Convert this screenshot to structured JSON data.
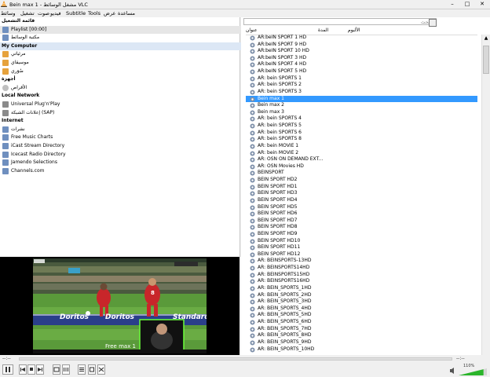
{
  "window": {
    "title": "Bein max 1 - مشغل الوسائط VLC",
    "controls": [
      "–",
      "□",
      "✕"
    ]
  },
  "menu": [
    "وسائط",
    "تشغيل",
    "صوت",
    "فيديو",
    "Subtitle",
    "Tools",
    "عرض",
    "مساعدة"
  ],
  "sidebar": {
    "sections": [
      {
        "header": "قائمة التشغيل",
        "items": [
          {
            "label": "Playlist [00:00]",
            "icon": "playlist-icon",
            "selected": true
          },
          {
            "label": "مكتبة الوسائط",
            "icon": "library-icon"
          }
        ]
      },
      {
        "header": "My Computer",
        "highlight": true,
        "items": [
          {
            "label": "مرئياتي",
            "icon": "video-folder-icon"
          },
          {
            "label": "موسيقاي",
            "icon": "music-folder-icon"
          },
          {
            "label": "صُوَري",
            "icon": "pictures-folder-icon"
          }
        ]
      },
      {
        "header": "أجهزة",
        "items": [
          {
            "label": "الأقراص",
            "icon": "disc-icon"
          }
        ]
      },
      {
        "header": "Local Network",
        "items": [
          {
            "label": "Universal Plug'n'Play",
            "icon": "network-icon"
          },
          {
            "label": "إعلانات الشبكة (SAP)",
            "icon": "network-icon"
          }
        ]
      },
      {
        "header": "Internet",
        "items": [
          {
            "label": "نشرات",
            "icon": "podcast-icon"
          },
          {
            "label": "Free Music Charts",
            "icon": "music-charts-icon"
          },
          {
            "label": "iCast Stream Directory",
            "icon": "icast-icon"
          },
          {
            "label": "Icecast Radio Directory",
            "icon": "icecast-icon"
          },
          {
            "label": "Jamendo Selections",
            "icon": "jamendo-icon"
          },
          {
            "label": "Channels.com",
            "icon": "channels-icon"
          }
        ]
      }
    ]
  },
  "video": {
    "overlay_text": "Free max 1",
    "ad_text": "Doritos",
    "ad_text_2": "Standard",
    "player_number": "8"
  },
  "playlist": {
    "search_placeholder": "البحث",
    "columns": {
      "title": "عنوان",
      "duration": "المدة",
      "album": "الألبوم"
    },
    "items": [
      "AR:beIN SPORT 1 HD",
      "AR:beIN SPORT 9 HD",
      "AR:beIN SPORT 10 HD",
      "AR:beIN SPORT 3 HD",
      "AR:beIN SPORT 4 HD",
      "AR:beIN SPORT 5 HD",
      "AR:  bein SPORTS 1",
      "AR: bein SPORTS 2",
      "AR: bein SPORTS 3",
      "Bein max 1",
      "Bein max 2",
      "Bein max 3",
      "AR: bein SPORTS 4",
      "AR: bein SPORTS 5",
      "AR: bein SPORTS 6",
      "AR: bein SPORTS 8",
      "AR: bein MOVIE 1",
      "AR: bein MOVIE 2",
      "AR:  OSN ON DEMAND EXT...",
      "AR:  OSN Movies HD",
      "BEINSPORT",
      "BEIN SPORT HD2",
      "BEIN SPORT HD1",
      "BEIN SPORT HD3",
      "BEIN SPORT HD4",
      "BEIN SPORT HD5",
      "BEIN SPORT HD6",
      "BEIN SPORT HD7",
      "BEIN SPORT HD8",
      "BEIN SPORT HD9",
      "BEIN SPORT HD10",
      "BEIN SPORT HD11",
      "BEIN SPORT HD12",
      "AR: BEINSPORTS-13HD",
      "AR: BEINSPORTS14HD",
      "AR: BEINSPORTS15HD",
      "AR: BEINSPORTS16HD",
      "AR: BEIN_SPORTS_1HD",
      "AR: BEIN_SPORTS_2HD",
      "AR: BEIN_SPORTS_3HD",
      "AR: BEIN_SPORTS_4HD",
      "AR: BEIN_SPORTS_5HD",
      "AR: BEIN_SPORTS_6HD",
      "AR: BEIN_SPORTS_7HD",
      "AR: BEIN_SPORTS_8HD",
      "AR: BEIN_SPORTS_9HD",
      "AR: BEIN_SPORTS_10HD"
    ],
    "selected_index": 9
  },
  "seek": {
    "elapsed": "--:--",
    "remaining": "--:--",
    "position": 0
  },
  "volume": {
    "label": "110%",
    "level": 1.1
  },
  "colors": {
    "selection": "#3399ff",
    "volume": "#2bb52b",
    "section_highlight": "#dce7f5"
  }
}
